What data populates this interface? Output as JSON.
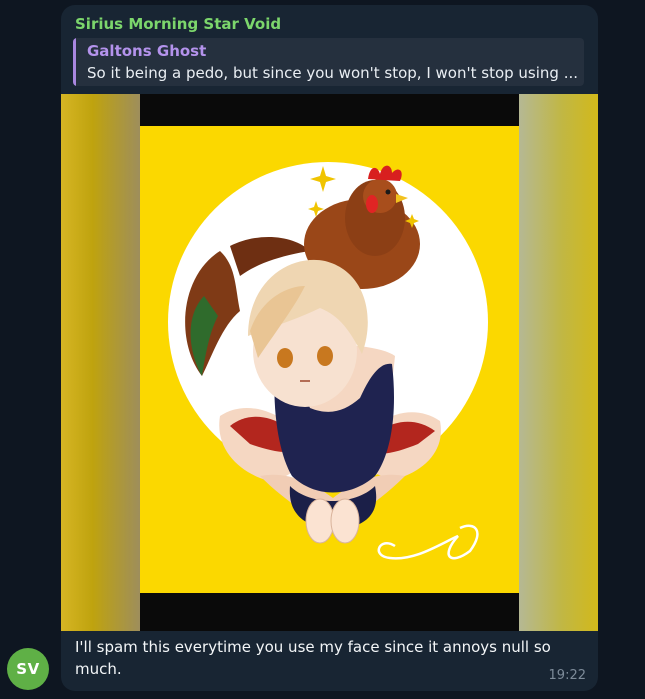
{
  "message": {
    "sender": {
      "name": "Sirius Morning Star Void",
      "initials": "SV",
      "name_color": "#7cd66c",
      "avatar_color": "#5fb046"
    },
    "reply": {
      "author": "Galtons Ghost",
      "text": "So it being a pedo, but since you won't stop, I won't stop using ...",
      "accent_color": "#a987e0"
    },
    "media": {
      "type": "image",
      "background_color": "#fbd800"
    },
    "text": "I'll spam this everytime you use my face since it annoys null so much.",
    "time": "19:22"
  }
}
